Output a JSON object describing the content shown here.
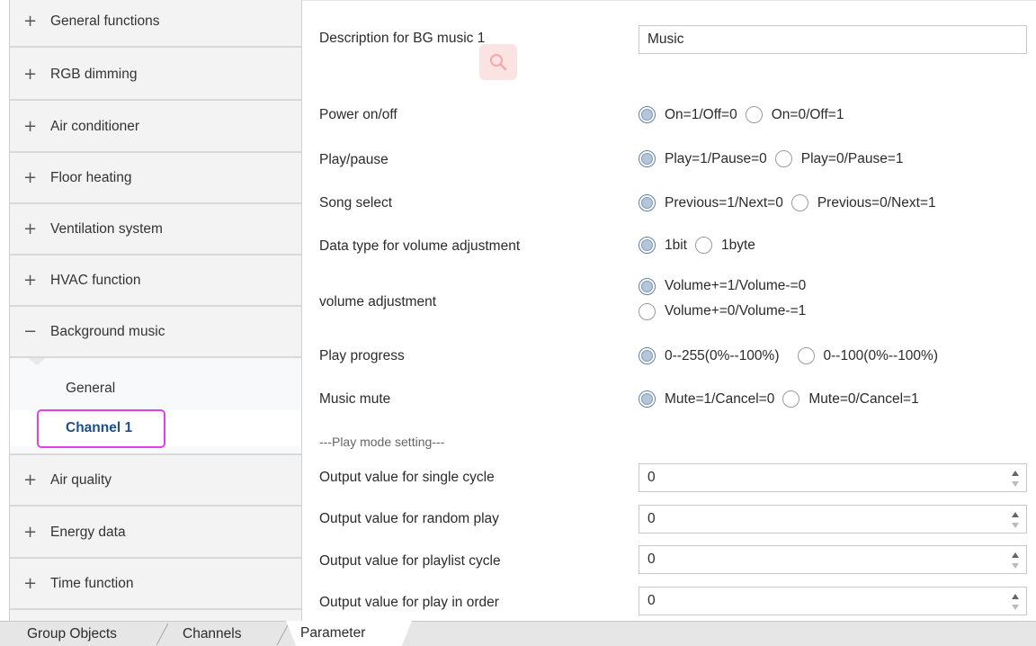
{
  "sidebar": {
    "items": [
      {
        "sign": "+",
        "label": "General functions"
      },
      {
        "sign": "+",
        "label": "RGB dimming"
      },
      {
        "sign": "+",
        "label": "Air conditioner"
      },
      {
        "sign": "+",
        "label": "Floor heating"
      },
      {
        "sign": "+",
        "label": "Ventilation system"
      },
      {
        "sign": "+",
        "label": "HVAC function"
      },
      {
        "sign": "−",
        "label": "Background music"
      },
      {
        "sign": "+",
        "label": "Air quality"
      },
      {
        "sign": "+",
        "label": "Energy data"
      },
      {
        "sign": "+",
        "label": "Time function"
      }
    ],
    "subitems": [
      {
        "label": "General"
      },
      {
        "label": "Channel 1"
      }
    ]
  },
  "main": {
    "description": {
      "label": "Description for BG music 1",
      "value": "Music"
    },
    "power": {
      "label": "Power on/off",
      "opt1": "On=1/Off=0",
      "opt2": "On=0/Off=1",
      "selected": 1
    },
    "play": {
      "label": "Play/pause",
      "opt1": "Play=1/Pause=0",
      "opt2": "Play=0/Pause=1",
      "selected": 1
    },
    "song": {
      "label": "Song select",
      "opt1": "Previous=1/Next=0",
      "opt2": "Previous=0/Next=1",
      "selected": 1
    },
    "datatype": {
      "label": "Data type for volume adjustment",
      "opt1": "1bit",
      "opt2": "1byte",
      "selected": 1
    },
    "volume": {
      "label": "volume adjustment",
      "opt1": "Volume+=1/Volume-=0",
      "opt2": "Volume+=0/Volume-=1",
      "selected": 1
    },
    "progress": {
      "label": "Play progress",
      "opt1": "0--255(0%--100%)",
      "opt2": "0--100(0%--100%)",
      "selected": 1
    },
    "mute": {
      "label": "Music mute",
      "opt1": "Mute=1/Cancel=0",
      "opt2": "Mute=0/Cancel=1",
      "selected": 1
    },
    "section_title": "---Play mode setting---",
    "single": {
      "label": "Output value for single cycle",
      "value": "0"
    },
    "random": {
      "label": "Output value for random play",
      "value": "0"
    },
    "playlist": {
      "label": "Output value for playlist cycle",
      "value": "0"
    },
    "order": {
      "label": "Output value for play in order",
      "value": "0"
    }
  },
  "tabs": {
    "group_objects": "Group Objects",
    "channels": "Channels",
    "parameter": "Parameter"
  },
  "colors": {
    "highlight": "#e040e8",
    "active_text": "#1b4f8a",
    "search_overlay": "#fbe3e3"
  }
}
